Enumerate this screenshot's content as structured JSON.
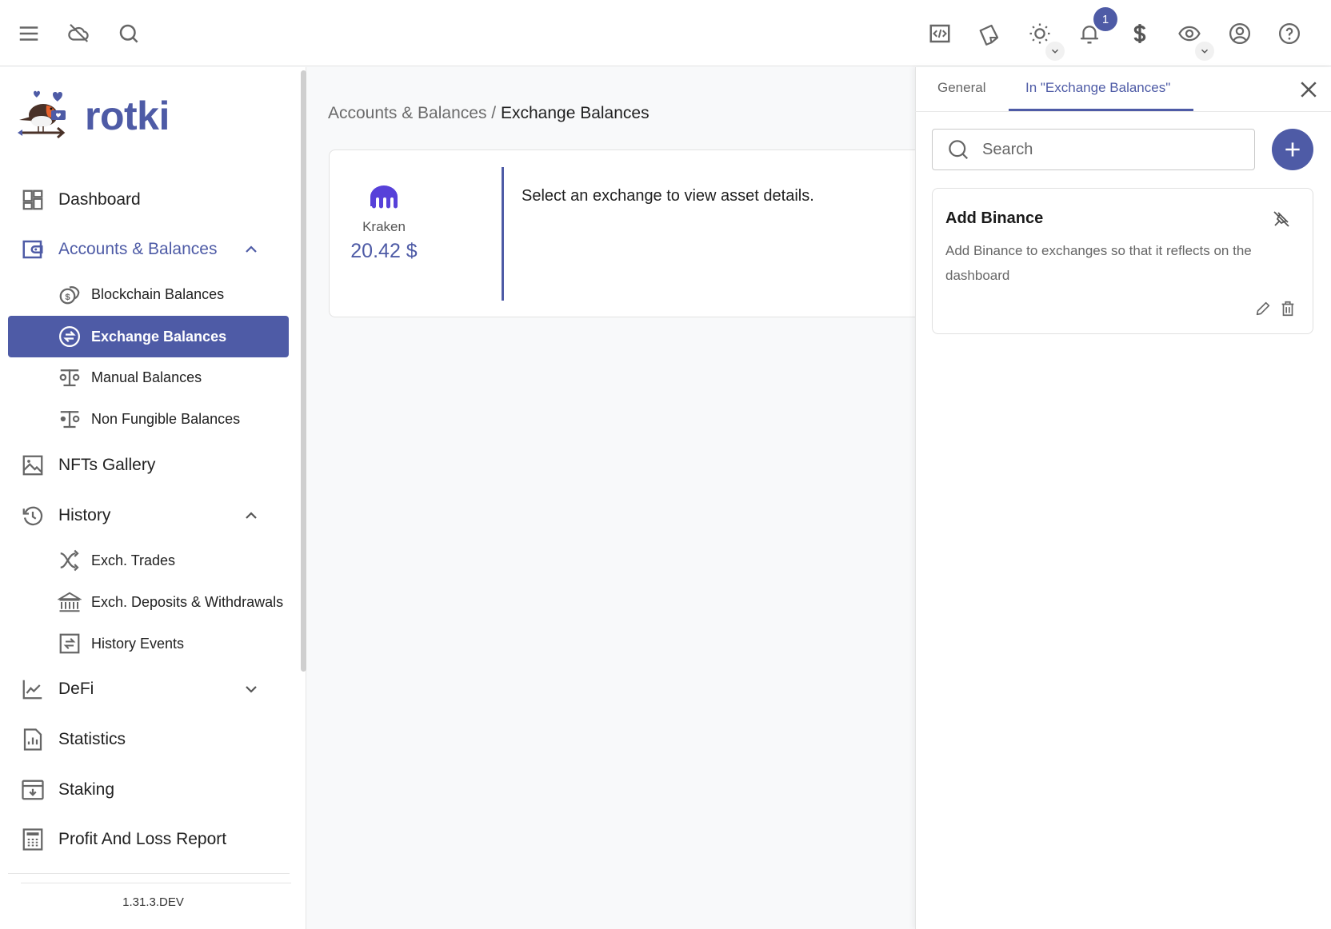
{
  "header": {
    "left_icons": [
      "menu-icon",
      "cloud-off-icon",
      "search-icon"
    ],
    "right_icons": [
      "code-icon",
      "sticky-note-icon",
      "theme-sun-icon",
      "bell-icon",
      "currency-dollar-icon",
      "eye-icon",
      "account-icon",
      "help-icon"
    ],
    "notification_count": "1"
  },
  "sidebar": {
    "logo_text": "rotki",
    "items": [
      {
        "label": "Dashboard",
        "icon": "dashboard-icon"
      },
      {
        "label": "Accounts & Balances",
        "icon": "wallet-icon",
        "expanded": true,
        "children": [
          {
            "label": "Blockchain Balances",
            "icon": "coins-icon"
          },
          {
            "label": "Exchange Balances",
            "icon": "exchange-icon",
            "active": true
          },
          {
            "label": "Manual Balances",
            "icon": "scale-icon"
          },
          {
            "label": "Non Fungible Balances",
            "icon": "scale-icon"
          }
        ]
      },
      {
        "label": "NFTs Gallery",
        "icon": "image-icon"
      },
      {
        "label": "History",
        "icon": "history-icon",
        "expanded": true,
        "children": [
          {
            "label": "Exch. Trades",
            "icon": "shuffle-icon"
          },
          {
            "label": "Exch. Deposits & Withdrawals",
            "icon": "bank-icon"
          },
          {
            "label": "History Events",
            "icon": "history-events-icon"
          }
        ]
      },
      {
        "label": "DeFi",
        "icon": "chart-line-icon",
        "expanded": false
      },
      {
        "label": "Statistics",
        "icon": "statistics-icon"
      },
      {
        "label": "Staking",
        "icon": "staking-icon"
      },
      {
        "label": "Profit And Loss Report",
        "icon": "calculator-icon"
      }
    ],
    "version": "1.31.3.DEV"
  },
  "main": {
    "breadcrumb": {
      "parent": "Accounts & Balances",
      "separator": " / ",
      "current": "Exchange Balances"
    },
    "exchanges": [
      {
        "name": "Kraken",
        "value": "20.42 $",
        "icon": "kraken-icon"
      }
    ],
    "empty_message": "Select an exchange to view asset details."
  },
  "panel": {
    "tabs": [
      {
        "label": "General",
        "active": false
      },
      {
        "label": "In \"Exchange Balances\"",
        "active": true
      }
    ],
    "search": {
      "placeholder": "Search",
      "value": ""
    },
    "notes": [
      {
        "title": "Add Binance",
        "body": "Add Binance to exchanges so that it reflects on the dashboard"
      }
    ]
  },
  "colors": {
    "accent": "#4e5ba6",
    "kraken": "#5741d9",
    "icon_gray": "#666666"
  }
}
